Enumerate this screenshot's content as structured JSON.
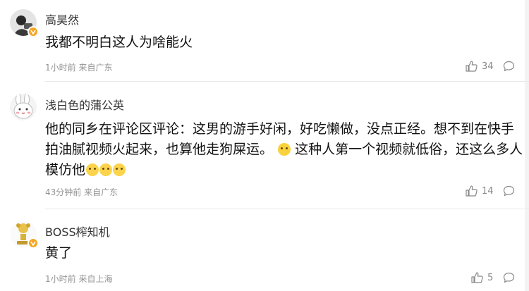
{
  "comments": [
    {
      "username": "高昊然",
      "text": "我都不明白这人为啥能火",
      "time": "1小时前",
      "location": "来自广东",
      "likes": "34"
    },
    {
      "username": "浅白色的蒲公英",
      "text_part1": "他的同乡在评论区评论：这男的游手好闲，好吃懒做，没点正经。想不到在快手拍油腻视频火起来，也算他走狗屎运。",
      "text_part2": "这种人第一个视频就低俗，还这么多人模仿他",
      "time": "43分钟前",
      "location": "来自广东",
      "likes": "14"
    },
    {
      "username": "BOSS榨知机",
      "text": "黄了",
      "time": "1小时前",
      "location": "来自上海",
      "likes": "5"
    }
  ],
  "colors": {
    "verified_badge": "#f5a623",
    "meta": "#939393"
  },
  "icons": {
    "like": "thumb-up-icon",
    "reply": "comment-bubble-icon",
    "verified": "verified-v-icon"
  }
}
